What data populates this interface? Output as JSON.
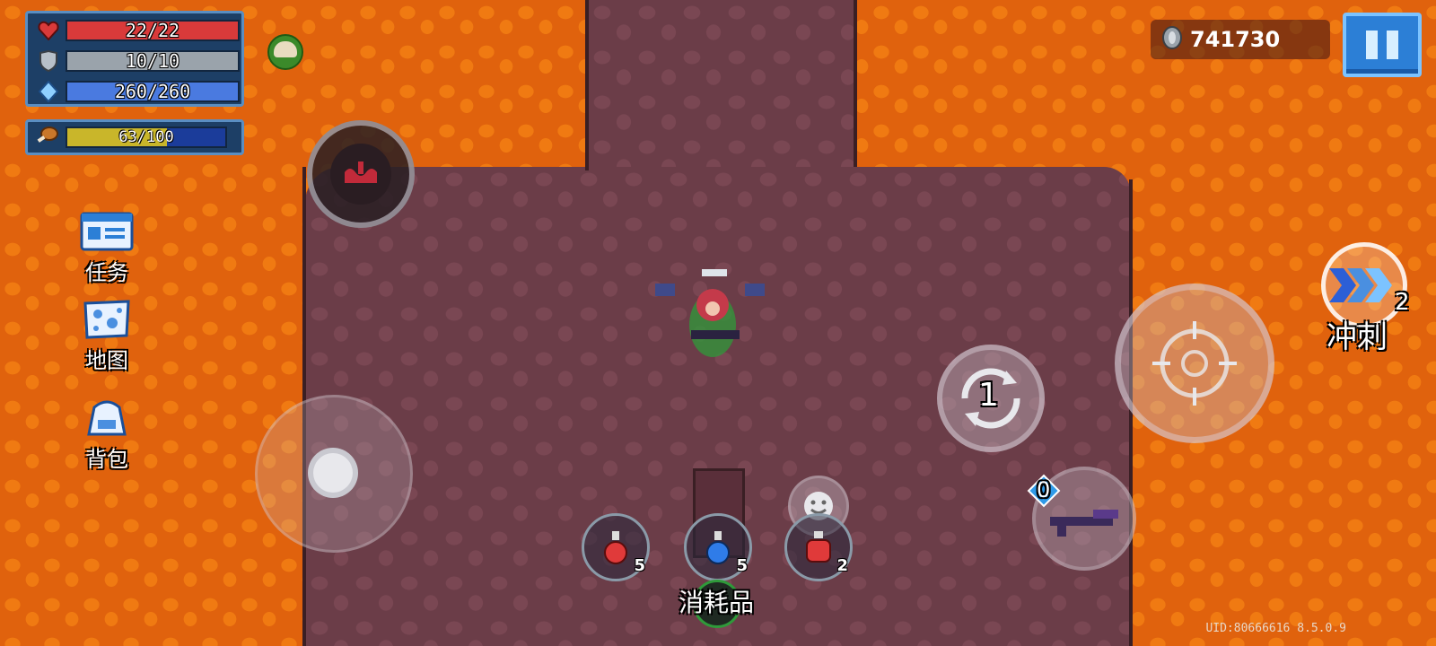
{
  "hud": {
    "health": {
      "text": "22/22",
      "value": 22,
      "max": 22,
      "color": "#d93a3a"
    },
    "armor": {
      "text": "10/10",
      "value": 10,
      "max": 10,
      "color": "#9aa3ab"
    },
    "energy": {
      "text": "260/260",
      "value": 260,
      "max": 260,
      "color": "#4a7ae0"
    },
    "hunger": {
      "text": "63/100",
      "value": 63,
      "max": 100,
      "color": "#c9b62a"
    }
  },
  "currency": {
    "icon": "gem-coin-icon",
    "value": "741730"
  },
  "menu": {
    "tasks_label": "任务",
    "map_label": "地图",
    "bag_label": "背包"
  },
  "controls": {
    "skill_charges": "1",
    "dash_label": "冲刺",
    "dash_count": "2",
    "weapon_energy": "0",
    "consumables_label": "消耗品"
  },
  "potions": [
    {
      "icon": "small-red-potion-icon",
      "count": "5",
      "color": "#e03a3a"
    },
    {
      "icon": "blue-potion-icon",
      "count": "5",
      "color": "#2f7ce8"
    },
    {
      "icon": "large-red-potion-icon",
      "count": "2",
      "color": "#e03a3a"
    }
  ],
  "footer": {
    "uid": "UID:80666616 8.5.0.9"
  }
}
